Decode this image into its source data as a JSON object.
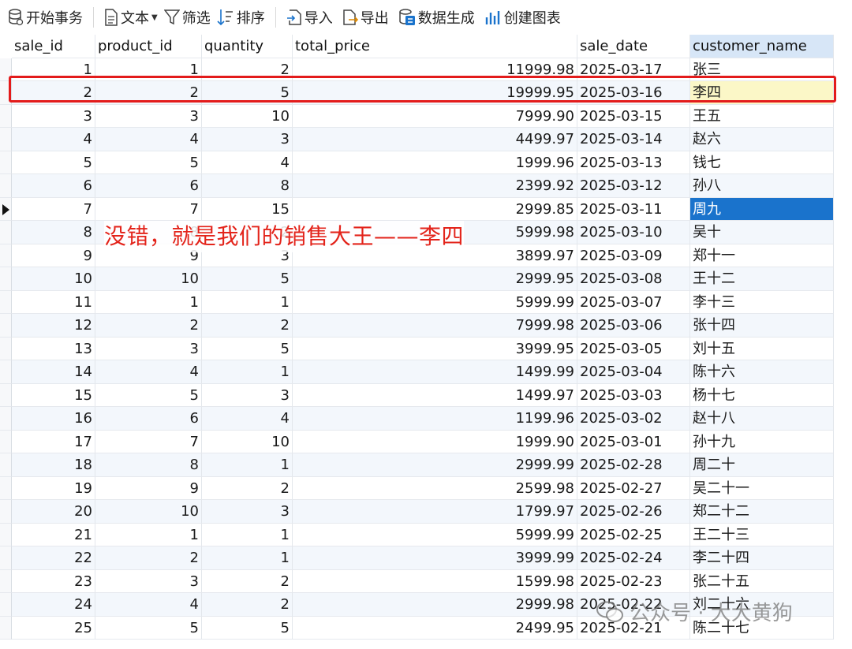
{
  "toolbar": {
    "begin_transaction": "开始事务",
    "text": "文本",
    "filter": "筛选",
    "sort": "排序",
    "import": "导入",
    "export": "导出",
    "generate_data": "数据生成",
    "create_chart": "创建图表"
  },
  "columns": [
    "sale_id",
    "product_id",
    "quantity",
    "total_price",
    "sale_date",
    "customer_name"
  ],
  "rows": [
    [
      "1",
      "1",
      "2",
      "11999.98",
      "2025-03-17",
      "张三"
    ],
    [
      "2",
      "2",
      "5",
      "19999.95",
      "2025-03-16",
      "李四"
    ],
    [
      "3",
      "3",
      "10",
      "7999.90",
      "2025-03-15",
      "王五"
    ],
    [
      "4",
      "4",
      "3",
      "4499.97",
      "2025-03-14",
      "赵六"
    ],
    [
      "5",
      "5",
      "4",
      "1999.96",
      "2025-03-13",
      "钱七"
    ],
    [
      "6",
      "6",
      "8",
      "2399.92",
      "2025-03-12",
      "孙八"
    ],
    [
      "7",
      "7",
      "15",
      "2999.85",
      "2025-03-11",
      "周九"
    ],
    [
      "8",
      "8",
      "2",
      "5999.98",
      "2025-03-10",
      "吴十"
    ],
    [
      "9",
      "9",
      "3",
      "3899.97",
      "2025-03-09",
      "郑十一"
    ],
    [
      "10",
      "10",
      "5",
      "2999.95",
      "2025-03-08",
      "王十二"
    ],
    [
      "11",
      "1",
      "1",
      "5999.99",
      "2025-03-07",
      "李十三"
    ],
    [
      "12",
      "2",
      "2",
      "7999.98",
      "2025-03-06",
      "张十四"
    ],
    [
      "13",
      "3",
      "5",
      "3999.95",
      "2025-03-05",
      "刘十五"
    ],
    [
      "14",
      "4",
      "1",
      "1499.99",
      "2025-03-04",
      "陈十六"
    ],
    [
      "15",
      "5",
      "3",
      "1499.97",
      "2025-03-03",
      "杨十七"
    ],
    [
      "16",
      "6",
      "4",
      "1199.96",
      "2025-03-02",
      "赵十八"
    ],
    [
      "17",
      "7",
      "10",
      "1999.90",
      "2025-03-01",
      "孙十九"
    ],
    [
      "18",
      "8",
      "1",
      "2999.99",
      "2025-02-28",
      "周二十"
    ],
    [
      "19",
      "9",
      "2",
      "2599.98",
      "2025-02-27",
      "吴二十一"
    ],
    [
      "20",
      "10",
      "3",
      "1799.97",
      "2025-02-26",
      "郑二十二"
    ],
    [
      "21",
      "1",
      "1",
      "5999.99",
      "2025-02-25",
      "王二十三"
    ],
    [
      "22",
      "2",
      "1",
      "3999.99",
      "2025-02-24",
      "李二十四"
    ],
    [
      "23",
      "3",
      "2",
      "1599.98",
      "2025-02-23",
      "张二十五"
    ],
    [
      "24",
      "4",
      "2",
      "2999.98",
      "2025-02-22",
      "刘二十六"
    ],
    [
      "25",
      "5",
      "5",
      "2499.95",
      "2025-02-21",
      "陈二十七"
    ]
  ],
  "annotation": "没错，就是我们的销售大王——李四",
  "watermark": "公众号 · 大大黄狗",
  "colors": {
    "annotation_red": "#e3241b",
    "selection_blue": "#1a73cc",
    "highlight_yellow": "#fbf7c7"
  }
}
